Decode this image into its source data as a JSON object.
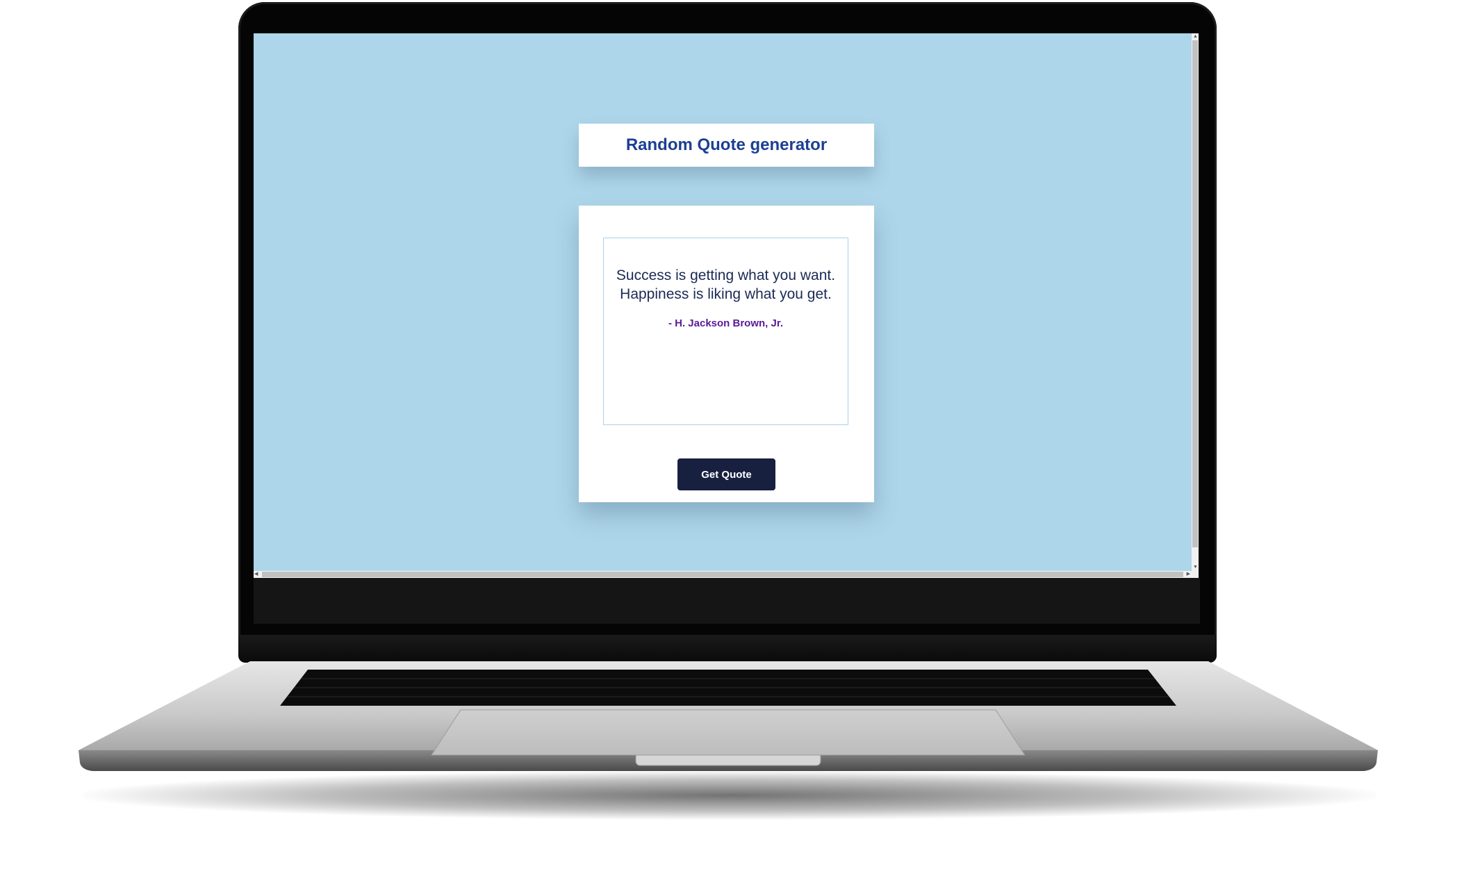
{
  "app": {
    "title": "Random Quote generator"
  },
  "quote": {
    "text": "Success is getting what you want. Happiness is liking what you get.",
    "author": "- H. Jackson Brown, Jr."
  },
  "controls": {
    "get_quote_label": "Get Quote"
  },
  "colors": {
    "background": "#aed6ea",
    "title": "#1c3f94",
    "quote_text": "#1b2a55",
    "author": "#5a1a96",
    "button": "#182040"
  }
}
